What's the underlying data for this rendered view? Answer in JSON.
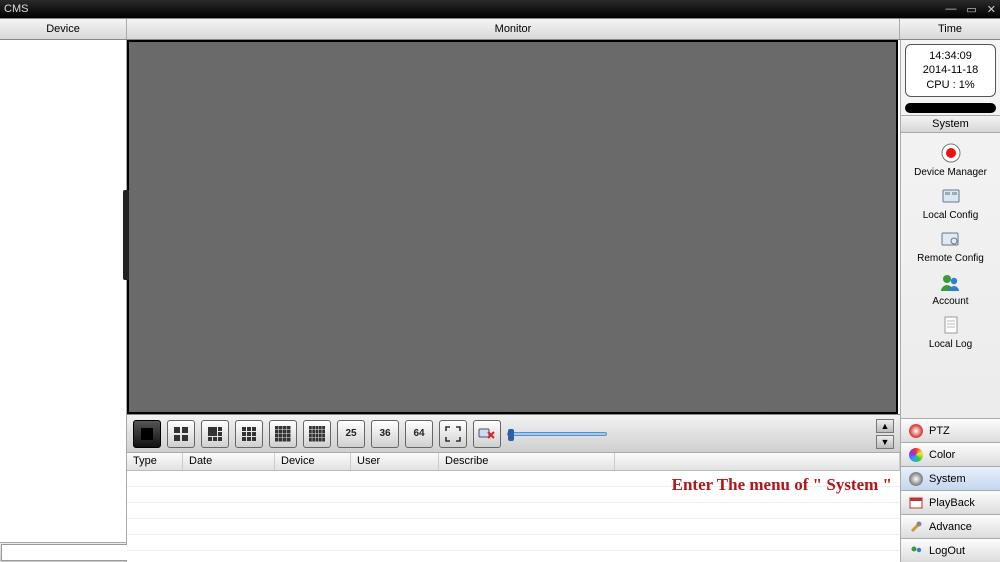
{
  "title": "CMS",
  "header": {
    "device": "Device",
    "monitor": "Monitor",
    "time": "Time"
  },
  "clock": {
    "time": "14:34:09",
    "date": "2014-11-18",
    "cpu": "CPU : 1%"
  },
  "system": {
    "heading": "System",
    "items": [
      {
        "label": "Device Manager"
      },
      {
        "label": "Local Config"
      },
      {
        "label": "Remote Config"
      },
      {
        "label": "Account"
      },
      {
        "label": "Local Log"
      }
    ]
  },
  "tabs": [
    {
      "label": "PTZ"
    },
    {
      "label": "Color"
    },
    {
      "label": "System"
    },
    {
      "label": "PlayBack"
    },
    {
      "label": "Advance"
    },
    {
      "label": "LogOut"
    }
  ],
  "toolbar": {
    "n25": "25",
    "n36": "36",
    "n64": "64"
  },
  "log": {
    "cols": {
      "type": "Type",
      "date": "Date",
      "device": "Device",
      "user": "User",
      "describe": "Describe"
    }
  },
  "annotation": "Enter The menu of \" System \""
}
